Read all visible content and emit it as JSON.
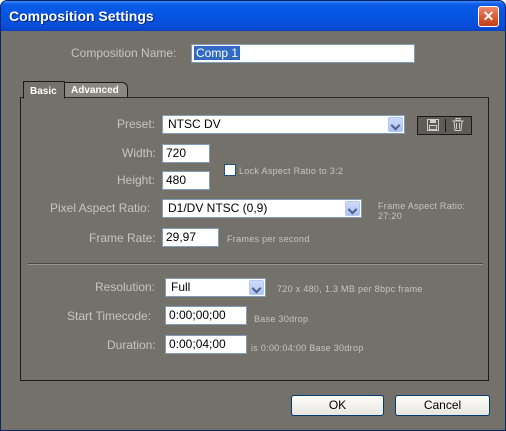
{
  "window": {
    "title": "Composition Settings"
  },
  "comp_name": {
    "label": "Composition Name:",
    "value": "Comp 1"
  },
  "tabs": [
    {
      "label": "Basic"
    },
    {
      "label": "Advanced"
    }
  ],
  "preset": {
    "label": "Preset:",
    "value": "NTSC DV"
  },
  "width": {
    "label": "Width:",
    "value": "720"
  },
  "height": {
    "label": "Height:",
    "value": "480"
  },
  "lock_aspect": {
    "label": "Lock Aspect Ratio to 3:2",
    "checked": false
  },
  "pixel_aspect": {
    "label": "Pixel Aspect Ratio:",
    "value": "D1/DV NTSC (0,9)",
    "info_line1": "Frame Aspect Ratio:",
    "info_line2": "27:20"
  },
  "frame_rate": {
    "label": "Frame Rate:",
    "value": "29,97",
    "unit": "Frames per second"
  },
  "resolution": {
    "label": "Resolution:",
    "value": "Full",
    "info": "720 x 480, 1.3 MB per 8bpc frame"
  },
  "start_timecode": {
    "label": "Start Timecode:",
    "value": "0:00;00;00",
    "info": "Base 30drop"
  },
  "duration": {
    "label": "Duration:",
    "value": "0:00;04;00",
    "info": "is 0:00:04:00  Base 30drop"
  },
  "buttons": {
    "ok": "OK",
    "cancel": "Cancel"
  },
  "colors": {
    "dialog_bg": "#74706a",
    "label_text": "#c8c5bf",
    "title_bar": "#0354e0"
  }
}
